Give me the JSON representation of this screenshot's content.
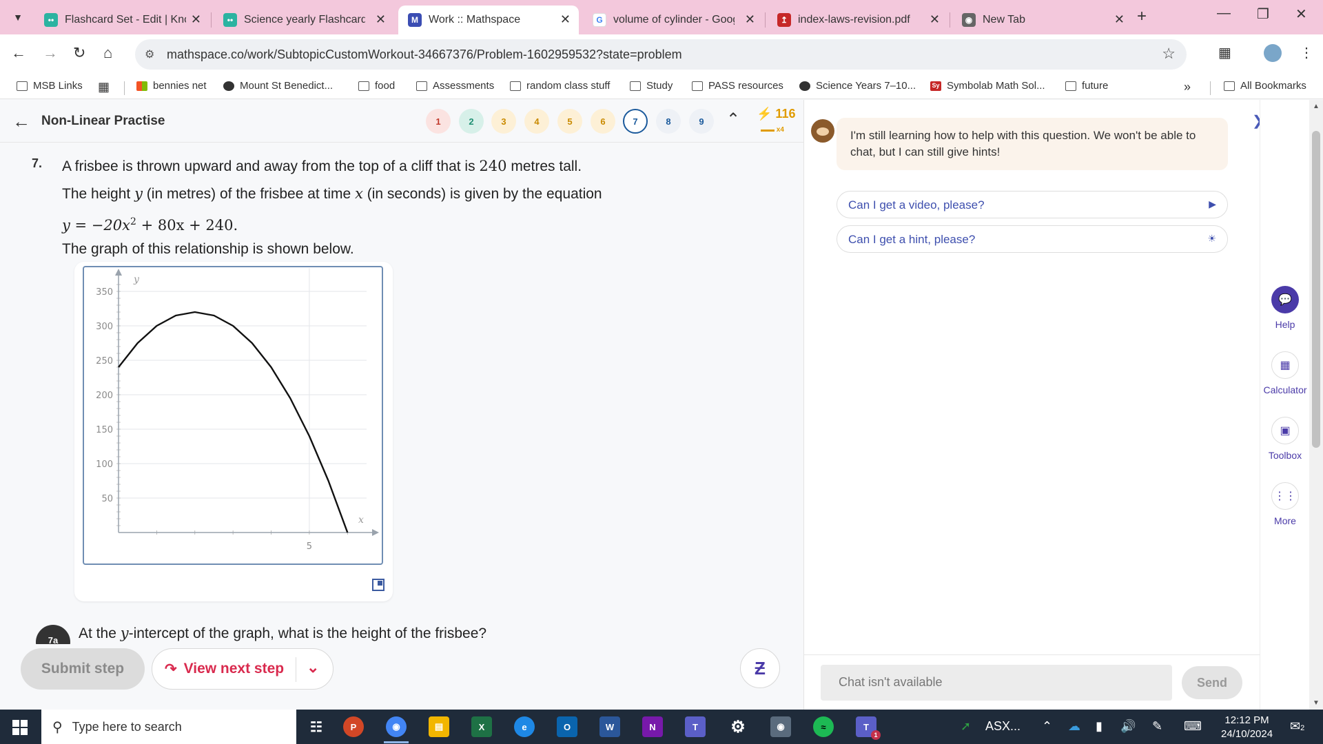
{
  "browser": {
    "tabs": [
      {
        "title": "Flashcard Set - Edit | Know",
        "icon": "knowt-icon",
        "color": "#2bb3a1",
        "active": false
      },
      {
        "title": "Science yearly Flashcards |",
        "icon": "knowt-icon",
        "color": "#2bb3a1",
        "active": false
      },
      {
        "title": "Work :: Mathspace",
        "icon": "mathspace-icon",
        "color": "#3b4db3",
        "active": true
      },
      {
        "title": "volume of cylinder - Googl",
        "icon": "google-icon",
        "color": "#4285f4",
        "active": false
      },
      {
        "title": "index-laws-revision.pdf",
        "icon": "pdf-icon",
        "color": "#c62828",
        "active": false
      },
      {
        "title": "New Tab",
        "icon": "chrome-icon",
        "color": "#666666",
        "active": false
      }
    ],
    "url": "mathspace.co/work/SubtopicCustomWorkout-34667376/Problem-1602959532?state=problem",
    "bookmarks": [
      {
        "label": "MSB Links",
        "icon": "folder-icon"
      },
      {
        "label": "bennies net",
        "icon": "windows-icon"
      },
      {
        "label": "Mount St Benedict...",
        "icon": "globe-icon"
      },
      {
        "label": "food",
        "icon": "folder-icon"
      },
      {
        "label": "Assessments",
        "icon": "folder-icon"
      },
      {
        "label": "random class stuff",
        "icon": "folder-icon"
      },
      {
        "label": "Study",
        "icon": "folder-icon"
      },
      {
        "label": "PASS resources",
        "icon": "folder-icon"
      },
      {
        "label": "Science Years 7–10...",
        "icon": "globe-icon"
      },
      {
        "label": "Symbolab Math Sol...",
        "icon": "symbolab-icon"
      },
      {
        "label": "future",
        "icon": "folder-icon"
      }
    ],
    "all_bookmarks": "All Bookmarks"
  },
  "header": {
    "title": "Non-Linear Practise",
    "questions": [
      {
        "n": "1",
        "bg": "#fbe3e1",
        "fg": "#c0392b"
      },
      {
        "n": "2",
        "bg": "#d7f0e9",
        "fg": "#1e8f72"
      },
      {
        "n": "3",
        "bg": "#fdf0d6",
        "fg": "#c98a00"
      },
      {
        "n": "4",
        "bg": "#fdf0d6",
        "fg": "#c98a00"
      },
      {
        "n": "5",
        "bg": "#fdf0d6",
        "fg": "#c98a00"
      },
      {
        "n": "6",
        "bg": "#fdf0d6",
        "fg": "#c98a00"
      },
      {
        "n": "7",
        "bg": "#ffffff",
        "fg": "#1b5a9c",
        "current": true
      },
      {
        "n": "8",
        "bg": "#eef1f6",
        "fg": "#1b5a9c"
      },
      {
        "n": "9",
        "bg": "#eef1f6",
        "fg": "#1b5a9c"
      }
    ],
    "streak": "116",
    "streak_mult": "x4"
  },
  "question": {
    "number": "7.",
    "line1_a": "A frisbee is thrown upward and away from the top of a cliff that is ",
    "line1_num": "240",
    "line1_b": " metres tall.",
    "line2_a": "The height ",
    "line2_var_y": "y",
    "line2_b": " (in metres) of the frisbee at time ",
    "line2_var_x": "x",
    "line2_c": " (in seconds) is given by the equation",
    "eq_lhs": "y = −20x",
    "eq_exp": "2",
    "eq_rhs": " + 80x + 240.",
    "line4": "The graph of this relationship is shown below.",
    "part_badge": "7a",
    "part_text_a": "At the ",
    "part_text_var": "y",
    "part_text_b": "-intercept of the graph, what is the height of the frisbee?"
  },
  "chart_data": {
    "type": "line",
    "function": "y = -20x^2 + 80x + 240",
    "x": [
      0,
      0.5,
      1,
      1.5,
      2,
      2.5,
      3,
      3.5,
      4,
      4.5,
      5,
      5.5,
      6
    ],
    "y": [
      240,
      275,
      300,
      315,
      320,
      315,
      300,
      275,
      240,
      195,
      140,
      75,
      0
    ],
    "xlabel": "x",
    "ylabel": "y",
    "x_ticks": [
      "5"
    ],
    "y_ticks": [
      "50",
      "100",
      "150",
      "200",
      "250",
      "300",
      "350"
    ],
    "xlim": [
      0,
      6.5
    ],
    "ylim": [
      0,
      370
    ],
    "grid": true
  },
  "footer": {
    "submit": "Submit step",
    "next": "View next step"
  },
  "chat": {
    "message": "I'm still learning how to help with this question. We won't be able to chat, but I can still give hints!",
    "chips": [
      "Can I get a video, please?",
      "Can I get a hint, please?"
    ],
    "placeholder": "Chat isn't available",
    "send": "Send"
  },
  "tools": [
    {
      "label": "Help",
      "icon": "chat-bubble-icon"
    },
    {
      "label": "Calculator",
      "icon": "calculator-icon"
    },
    {
      "label": "Toolbox",
      "icon": "toolbox-icon"
    },
    {
      "label": "More",
      "icon": "dots-grid-icon"
    }
  ],
  "taskbar": {
    "search": "Type here to search",
    "asx": "ASX...",
    "time": "12:12 PM",
    "date": "24/10/2024",
    "notif": "2",
    "teams_badge": "1"
  }
}
